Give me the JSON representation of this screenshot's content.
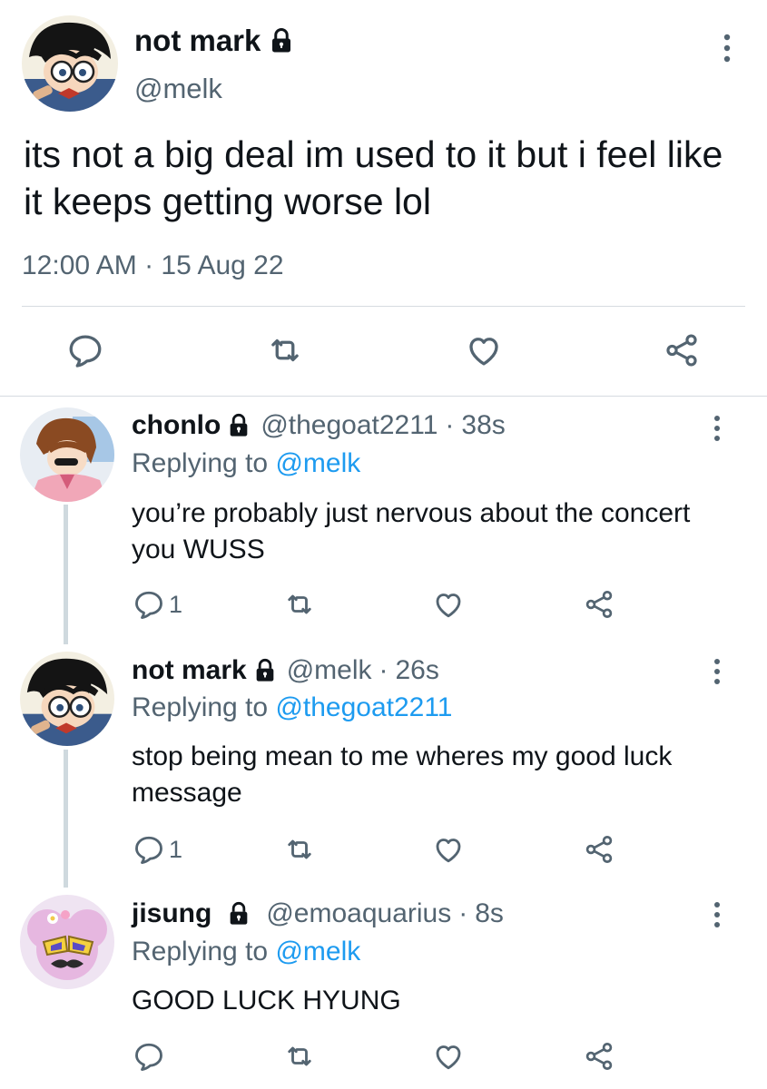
{
  "main": {
    "name": "not mark",
    "handle": "@melk",
    "text": "its not a big deal im used to it but i feel like it keeps getting worse lol",
    "timestamp": "12:00 AM · 15 Aug 22",
    "icons": [
      "lock-icon",
      "more-icon",
      "reply-icon",
      "retweet-icon",
      "like-icon",
      "share-icon"
    ]
  },
  "replies": [
    {
      "name": "chonlo",
      "handle": "@thegoat2211",
      "dot": "·",
      "time": "38s",
      "replying_prefix": "Replying to",
      "replying_to": "@melk",
      "text": "you’re probably just nervous about the concert you WUSS",
      "reply_count": "1"
    },
    {
      "name": "not mark",
      "handle": "@melk",
      "dot": "·",
      "time": "26s",
      "replying_prefix": "Replying to",
      "replying_to": "@thegoat2211",
      "text": "stop being mean to me wheres my good luck message",
      "reply_count": "1"
    },
    {
      "name": "jisung",
      "handle": "@emoaquarius",
      "dot": "·",
      "time": "8s",
      "replying_prefix": "Replying to",
      "replying_to": "@melk",
      "text": "GOOD LUCK HYUNG",
      "reply_count": ""
    }
  ],
  "colors": {
    "text": "#0f1419",
    "secondary": "#536471",
    "link": "#1d9bf0",
    "divider": "#d6dbe0",
    "thread_line": "#cfd9de"
  }
}
